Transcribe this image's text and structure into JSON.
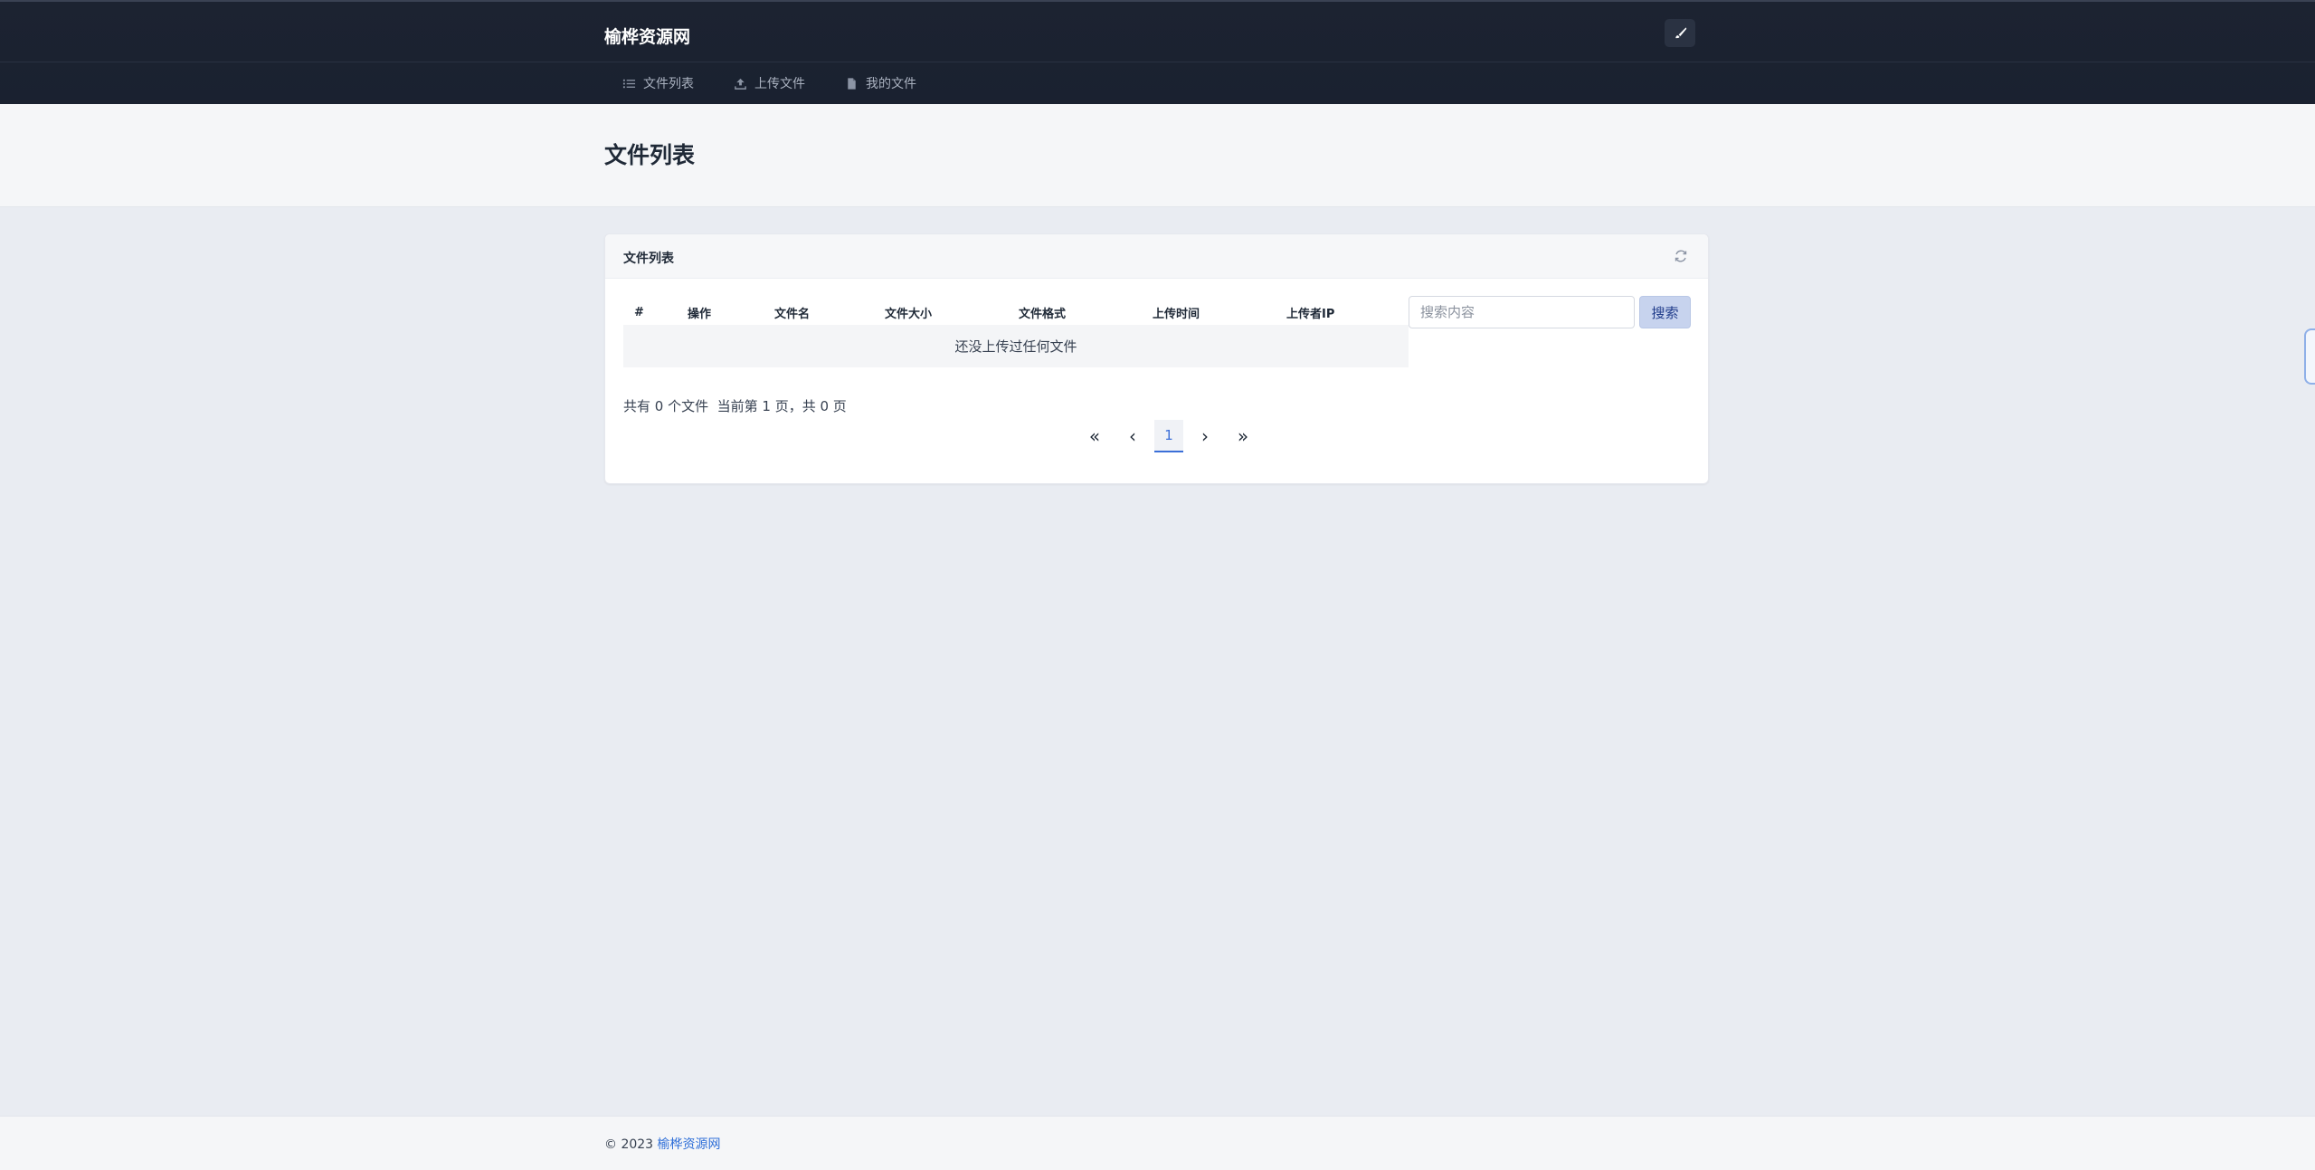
{
  "header": {
    "brand": "榆桦资源网",
    "theme_toggle_icon": "brush-icon",
    "nav": [
      {
        "label": "文件列表",
        "icon": "list-icon"
      },
      {
        "label": "上传文件",
        "icon": "upload-icon"
      },
      {
        "label": "我的文件",
        "icon": "file-icon"
      }
    ]
  },
  "page": {
    "title": "文件列表"
  },
  "card": {
    "title": "文件列表",
    "columns": [
      "#",
      "操作",
      "文件名",
      "文件大小",
      "文件格式",
      "上传时间",
      "上传者IP"
    ],
    "empty_message": "还没上传过任何文件",
    "search": {
      "placeholder": "搜索内容",
      "button_label": "搜索"
    },
    "summary": "共有 0 个文件  当前第 1 页，共 0 页",
    "pagination": {
      "first": "«",
      "prev": "‹",
      "current": "1",
      "next": "›",
      "last": "»"
    }
  },
  "footer": {
    "copyright": "© 2023",
    "link": "榆桦资源网"
  },
  "colors": {
    "accent": "#3b6fd8",
    "topbar": "#1c2331"
  }
}
